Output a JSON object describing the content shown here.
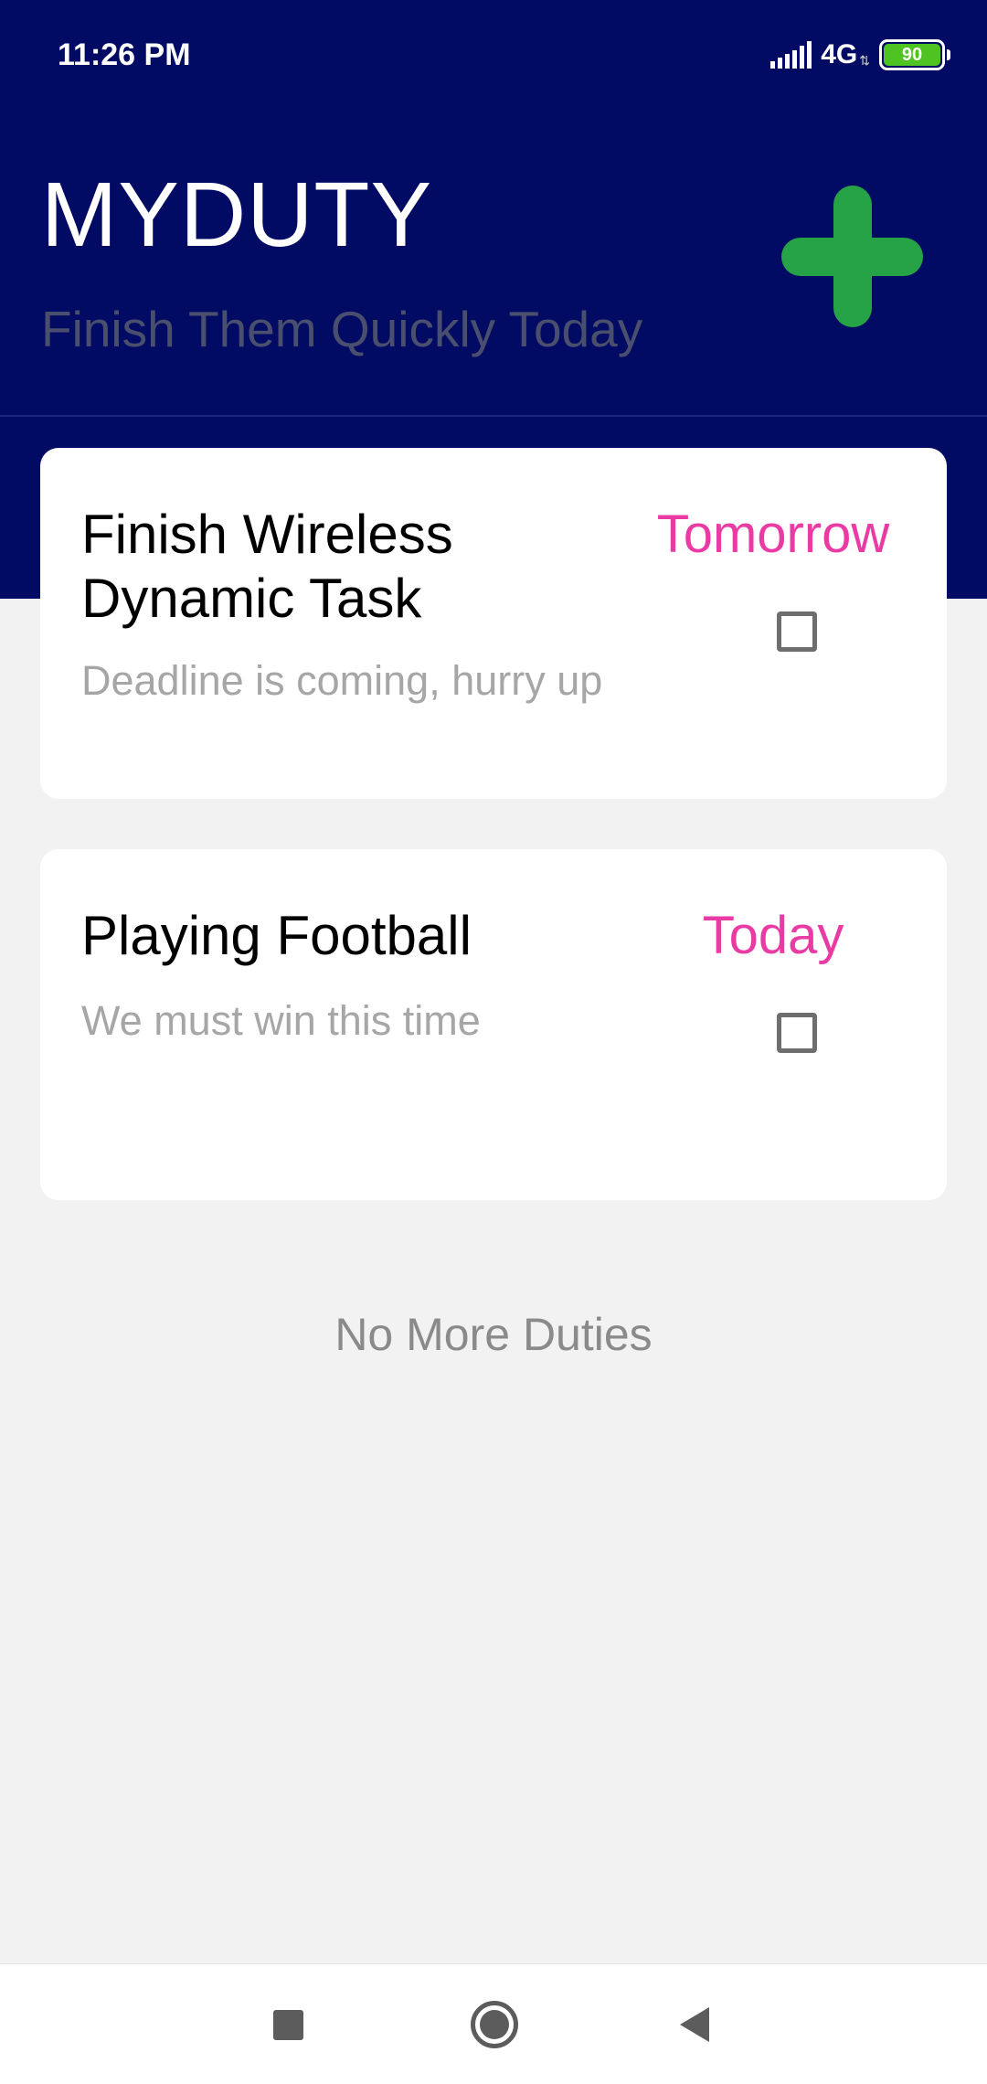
{
  "status_bar": {
    "time": "11:26 PM",
    "network": "4G",
    "network_arrows": "⇅",
    "battery": "90"
  },
  "header": {
    "title": "MYDUTY",
    "subtitle": "Finish Them Quickly Today",
    "add_icon": "plus-icon"
  },
  "duties": [
    {
      "title": "Finish Wireless Dynamic Task",
      "description": "Deadline is coming, hurry up",
      "date": "Tomorrow",
      "done": false
    },
    {
      "title": "Playing Football",
      "description": "We must win this time",
      "date": "Today",
      "done": false
    }
  ],
  "empty_note": "No More Duties",
  "nav": {
    "recents_icon": "square-icon",
    "home_icon": "circle-icon",
    "back_icon": "triangle-back-icon"
  },
  "colors": {
    "header_bg": "#020b64",
    "accent_add": "#26a346",
    "date_text": "#ea3ba4",
    "page_bg": "#f2f2f2"
  }
}
